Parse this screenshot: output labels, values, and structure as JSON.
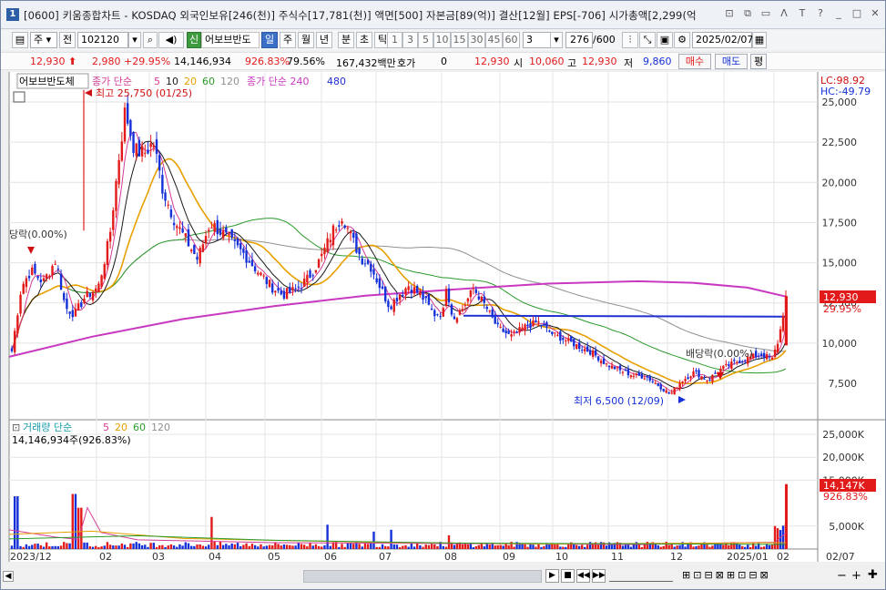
{
  "window": {
    "number": "1",
    "title": "[0600] 키움종합차트 - KOSDAQ 외국인보유[246(천)] 주식수[17,781(천)] 액면[500] 자본금[89(억)] 결산[12월] EPS[-706] 시가총액[2,299(억"
  },
  "toolbar": {
    "type_label": "주",
    "jeon_label": "전",
    "code": "102120",
    "badge": "신",
    "stock_name": "어보브반도",
    "periods": [
      "일",
      "주",
      "월",
      "년",
      "분",
      "초",
      "틱"
    ],
    "selected_period": "일",
    "minutes": [
      "1",
      "3",
      "5",
      "10",
      "15",
      "30",
      "45",
      "60"
    ],
    "tick_value": "3",
    "count_value": "276",
    "count_max": "/600",
    "date": "2025/02/07"
  },
  "quote": {
    "price": "12,930",
    "change": "2,980",
    "change_pct": "+29.95%",
    "volume": "14,146,934",
    "vol_ratio": "926.83%",
    "rate2": "79.56%",
    "amount": "167,432백만",
    "hoga_label": "호가",
    "hoga_value": "0",
    "hoga_price": "12,930",
    "open_label": "시",
    "open": "10,060",
    "high_label": "고",
    "high": "12,930",
    "low_label": "저",
    "low": "9,860",
    "buy_label": "매수",
    "sell_label": "매도",
    "pyeong_label": "평"
  },
  "chart": {
    "name_tag": "어보브반도체",
    "legend_price_ma": "종가 단순",
    "ma_periods": [
      "5",
      "10",
      "20",
      "60",
      "120"
    ],
    "legend_long_ma": "종가 단순 240",
    "long_ma_2": "480",
    "lc": "LC:98.92",
    "hc": "HC:-49.79",
    "high_annot": "최고 25,750 (01/25)",
    "low_annot": "최저 6,500 (12/09)",
    "div_annot_left": "당락(0.00%)",
    "div_annot_right": "배당락(0.00%)",
    "price_ticks": [
      "25,000",
      "22,500",
      "20,000",
      "17,500",
      "15,000",
      "12,500",
      "10,000",
      "7,500"
    ],
    "current_price_label": "12,930",
    "current_pct_label": "29.95%",
    "volume_legend": "거래량 단순",
    "volume_ma": [
      "5",
      "20",
      "60",
      "120"
    ],
    "volume_value": "14,146,934주(926.83%)",
    "volume_ticks": [
      "25,000K",
      "20,000K",
      "15,000K",
      "5,000K"
    ],
    "volume_current": "14,147K",
    "volume_pct": "926.83%",
    "x_labels": [
      "2023/12",
      "02",
      "03",
      "04",
      "05",
      "06",
      "07",
      "08",
      "09",
      "10",
      "11",
      "12",
      "2025/01",
      "02",
      "02/07"
    ]
  },
  "colors": {
    "up": "#e31a1a",
    "down": "#1530d8",
    "ma5": "#d43c97",
    "ma10": "#1a1a1a",
    "ma20": "#e8a000",
    "ma60": "#2a9a2a",
    "ma120": "#909090",
    "ma240": "#c838c0",
    "ma480": "#2030d0"
  }
}
